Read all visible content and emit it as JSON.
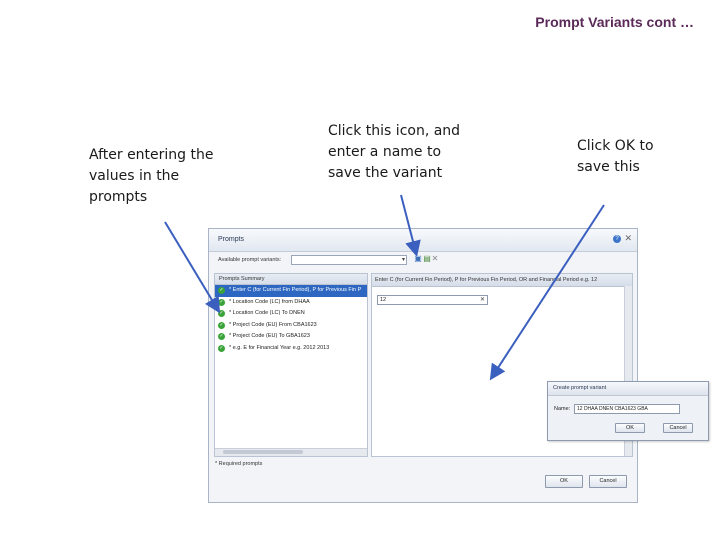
{
  "slide": {
    "title": "Prompt Variants cont …",
    "note_left": "After entering the values in the prompts",
    "note_middle": "Click this icon, and enter a name to save the variant",
    "note_right": "Click OK to save this"
  },
  "prompts_dialog": {
    "title": "Prompts",
    "available_variants_label": "Available prompt variants:",
    "summary_header": "Prompts Summary",
    "summary_items": [
      "* Enter C (for Current Fin Period), P for Previous Fin P",
      "* Location Code (LC) from DHAA",
      "* Location Code (LC) To DNEN",
      "* Project Code (EU) From CBA1623",
      "* Project Code (EU) To GBA1623",
      "* e.g. E for Financial Year e.g. 2012 2013"
    ],
    "detail_header": "Enter C (for Current Fin Period), P for Previous Fin Period, OR and Financial Period e.g. 12",
    "value": "12",
    "required_note": "* Required prompts",
    "ok_label": "OK",
    "cancel_label": "Cancel"
  },
  "create_variant_dialog": {
    "title": "Create prompt variant",
    "name_label": "Name:",
    "name_value": "12 DHAA DNEN CBA1623 GBA",
    "ok_label": "OK",
    "cancel_label": "Cancel"
  },
  "colors": {
    "title": "#5b2a59",
    "selected_row": "#2d67c1",
    "check": "#3aa33a",
    "arrow": "#3a5fbf"
  },
  "icons": {
    "help": "help-icon",
    "close": "close-icon",
    "check": "check-icon",
    "save_variant": "save-variant-icon",
    "delete_variant": "delete-variant-icon"
  }
}
